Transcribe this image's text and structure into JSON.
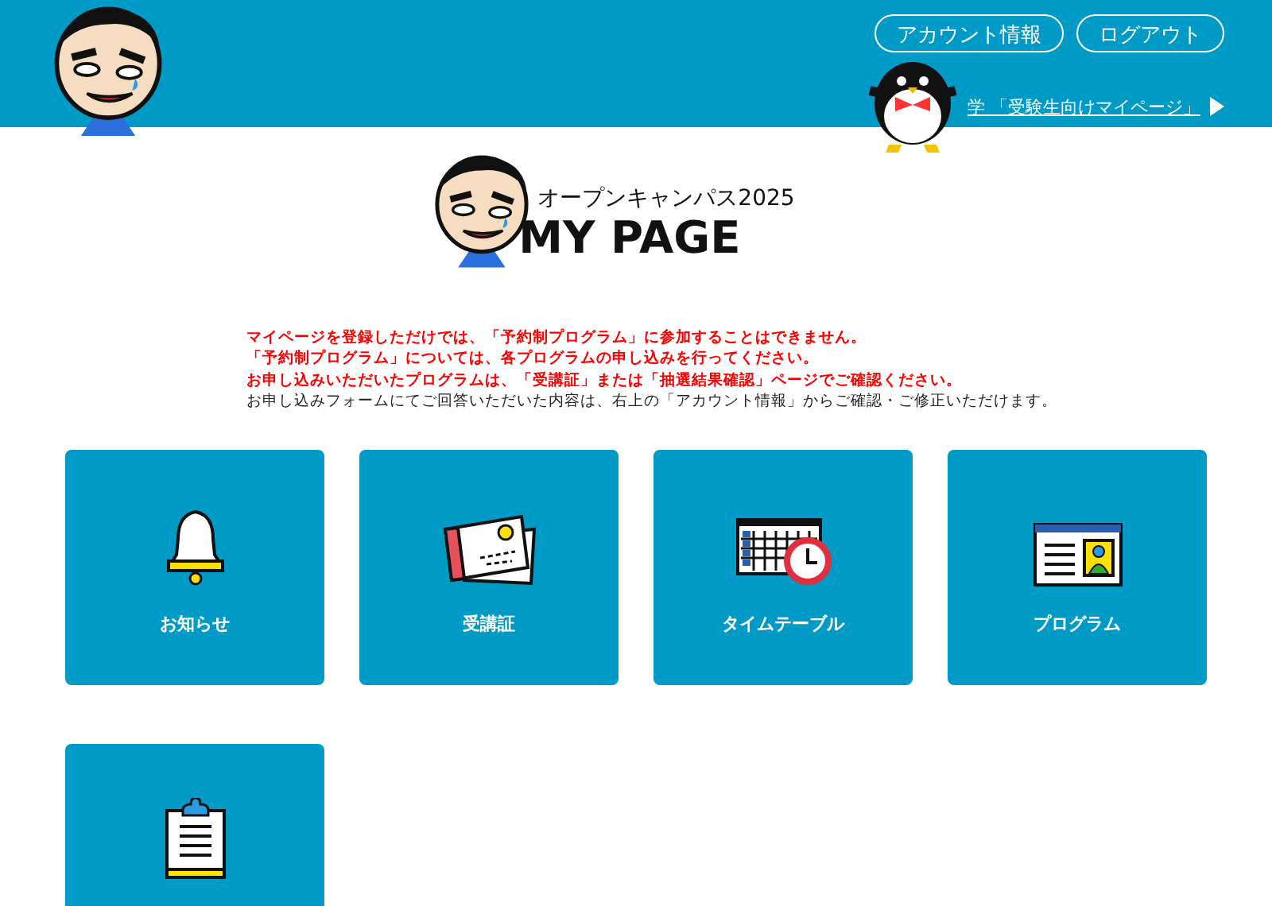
{
  "header": {
    "buttons": [
      {
        "label": "アカウント情報"
      },
      {
        "label": "ログアウト"
      }
    ],
    "link": {
      "label": "学 「受験生向けマイページ」"
    }
  },
  "logo": {
    "subtitle": "オープンキャンパス2025",
    "title": "MY PAGE"
  },
  "notices": [
    {
      "kind": "warning",
      "text": "マイページを登録しただけでは、「予約制プログラム」に参加することはできません。"
    },
    {
      "kind": "warning",
      "text": "「予約制プログラム」については、各プログラムの申し込みを行ってください。"
    },
    {
      "kind": "warning",
      "text": "お申し込みいただいたプログラムは、「受講証」または「抽選結果確認」ページでご確認ください。"
    },
    {
      "kind": "info",
      "text": "お申し込みフォームにてご回答いただいた内容は、右上の「アカウント情報」からご確認・ご修正いただけます。"
    }
  ],
  "cards": [
    {
      "kind": "bell",
      "label": "お知らせ"
    },
    {
      "kind": "ticket",
      "label": "受講証"
    },
    {
      "kind": "timetable",
      "label": "タイムテーブル"
    },
    {
      "kind": "profile",
      "label": "プログラム"
    },
    {
      "kind": "clipboard"
    }
  ]
}
